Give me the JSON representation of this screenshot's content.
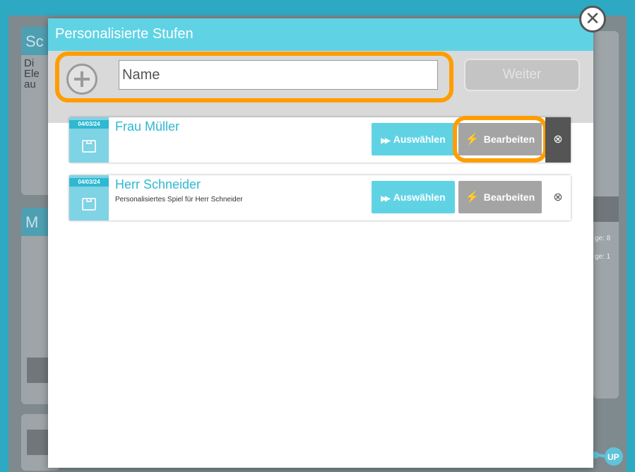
{
  "background": {
    "card_headers": [
      "Sc",
      "M"
    ],
    "card_text": "Di\nEle\nau",
    "side_texts": [
      "ge: 8",
      "ge: 1"
    ]
  },
  "modal": {
    "title": "Personalisierte Stufen",
    "close_icon": "close-circle-icon",
    "create": {
      "add_icon": "plus-circle-icon",
      "name_placeholder": "Name",
      "next_label": "Weiter"
    },
    "levels": [
      {
        "date": "04/03/24",
        "name": "Frau Müller",
        "description": "",
        "select_label": "Auswählen",
        "edit_label": "Bearbeiten",
        "delete_icon": "delete-circle-x-icon"
      },
      {
        "date": "04/03/24",
        "name": "Herr Schneider",
        "description": "Personalisiertes Spiel für Herr Schneider",
        "select_label": "Auswählen",
        "edit_label": "Bearbeiten",
        "delete_icon": "delete-circle-x-icon"
      }
    ]
  },
  "colors": {
    "accent": "#5fd3e4",
    "highlight": "#ff9d00",
    "edit_button": "#a4a4a4"
  }
}
